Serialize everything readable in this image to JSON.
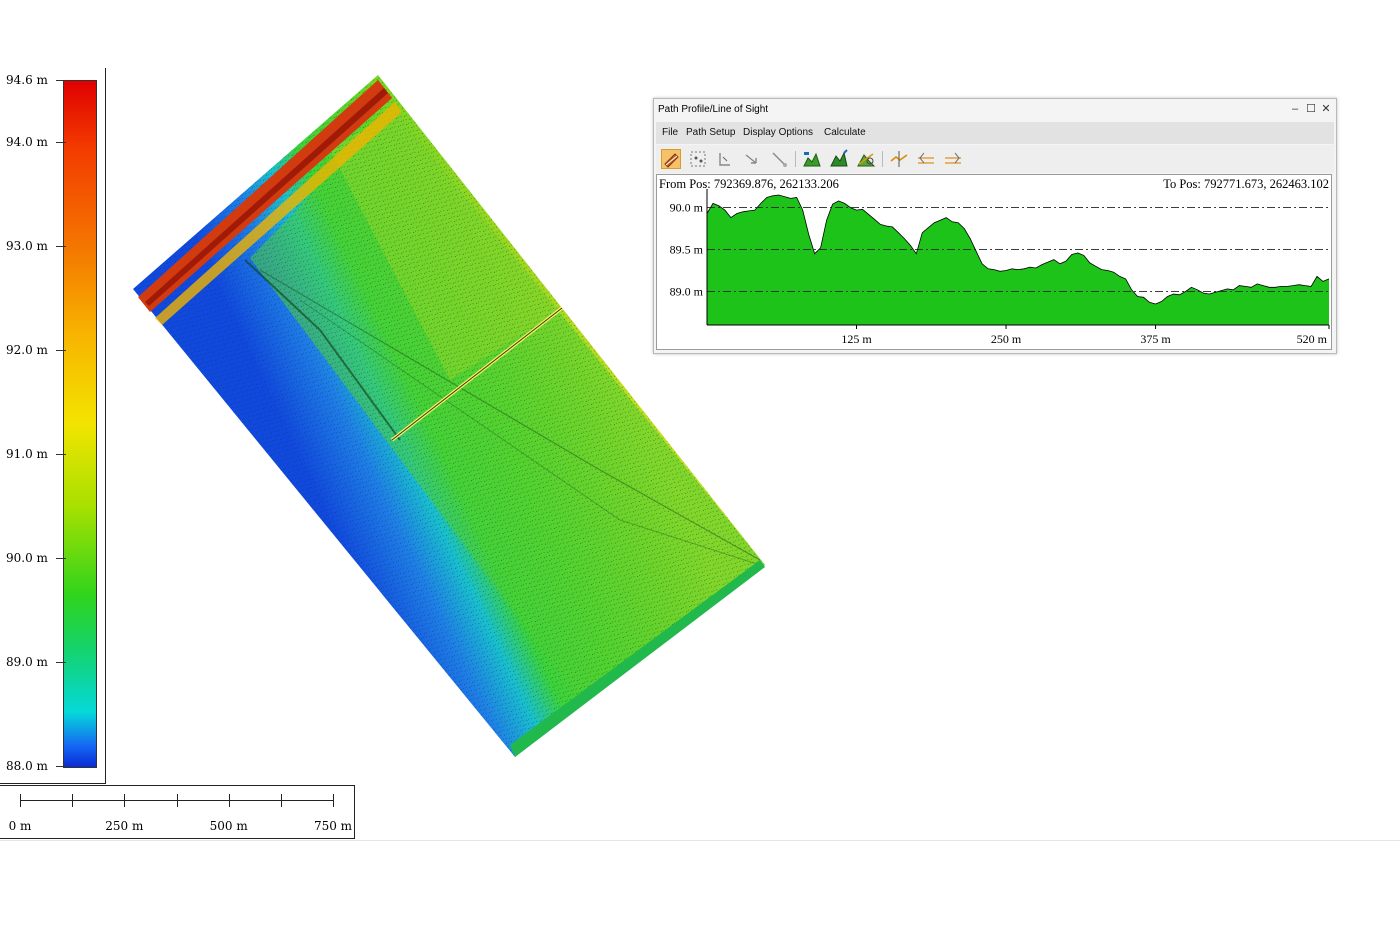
{
  "legend": {
    "ticks": [
      {
        "label": "94.6 m",
        "value": 94.6
      },
      {
        "label": "94.0 m",
        "value": 94.0
      },
      {
        "label": "93.0 m",
        "value": 93.0
      },
      {
        "label": "92.0 m",
        "value": 92.0
      },
      {
        "label": "91.0 m",
        "value": 91.0
      },
      {
        "label": "90.0 m",
        "value": 90.0
      },
      {
        "label": "89.0 m",
        "value": 89.0
      },
      {
        "label": "88.0 m",
        "value": 88.0
      }
    ],
    "min": 88.0,
    "max": 94.6,
    "colors_top_to_bottom": [
      "#e00000",
      "#f47a00",
      "#f2e400",
      "#2fd41c",
      "#05d9d9",
      "#0a2bd4"
    ]
  },
  "scale_bar": {
    "labels": [
      {
        "label": "0 m",
        "value": 0
      },
      {
        "label": "250 m",
        "value": 250
      },
      {
        "label": "500 m",
        "value": 500
      },
      {
        "label": "750 m",
        "value": 750
      }
    ],
    "max": 750,
    "minor_step": 125
  },
  "profile_window": {
    "title": "Path Profile/Line of Sight",
    "controls": {
      "minimize": "–",
      "maximize": "☐",
      "close": "✕"
    },
    "menu": [
      "File",
      "Path Setup",
      "Display Options",
      "Calculate"
    ],
    "toolbar_icons": [
      {
        "name": "draw-path-icon",
        "active": true
      },
      {
        "name": "select-points-icon",
        "active": false
      },
      {
        "name": "edit-points-icon",
        "active": false
      },
      {
        "name": "move-path-icon",
        "active": false
      },
      {
        "name": "clear-path-icon",
        "active": false
      },
      {
        "name": "terrain-profile-icon",
        "active": false
      },
      {
        "name": "terrain-fill-icon",
        "active": false
      },
      {
        "name": "line-of-sight-icon",
        "active": false
      },
      {
        "name": "add-marker-icon",
        "active": false
      },
      {
        "name": "prev-marker-icon",
        "active": false
      },
      {
        "name": "next-marker-icon",
        "active": false
      }
    ],
    "from_pos": "From Pos: 792369.876, 262133.206",
    "to_pos": "To Pos: 792771.673, 262463.102",
    "colors": {
      "fill": "#1ec31a",
      "stroke": "#000000",
      "gridline": "#222222"
    }
  },
  "chart_data": {
    "type": "area",
    "xlabel": "",
    "ylabel": "",
    "xlim": [
      0,
      520
    ],
    "ylim": [
      88.6,
      90.15
    ],
    "x_ticks": [
      {
        "label": "125 m",
        "value": 125
      },
      {
        "label": "250 m",
        "value": 250
      },
      {
        "label": "375 m",
        "value": 375
      },
      {
        "label": "520 m",
        "value": 520
      }
    ],
    "y_ticks": [
      {
        "label": "90.0 m",
        "value": 90.0
      },
      {
        "label": "89.5 m",
        "value": 89.5
      },
      {
        "label": "89.0 m",
        "value": 89.0
      }
    ],
    "grid": "dash-dot horizontal at y ticks",
    "x": [
      0,
      5,
      10,
      15,
      20,
      25,
      30,
      35,
      40,
      45,
      50,
      55,
      60,
      65,
      70,
      75,
      80,
      85,
      90,
      95,
      100,
      105,
      110,
      115,
      120,
      125,
      130,
      135,
      140,
      145,
      150,
      155,
      160,
      165,
      170,
      175,
      180,
      185,
      190,
      195,
      200,
      205,
      210,
      215,
      220,
      225,
      230,
      235,
      240,
      245,
      250,
      255,
      260,
      265,
      270,
      275,
      280,
      285,
      290,
      295,
      300,
      305,
      310,
      315,
      320,
      325,
      330,
      335,
      340,
      345,
      350,
      355,
      360,
      365,
      370,
      375,
      380,
      385,
      390,
      395,
      400,
      405,
      410,
      415,
      420,
      425,
      430,
      435,
      440,
      445,
      450,
      455,
      460,
      465,
      470,
      475,
      480,
      485,
      490,
      495,
      500,
      505,
      510,
      515,
      520
    ],
    "y": [
      89.93,
      90.05,
      90.02,
      89.97,
      89.88,
      89.93,
      89.95,
      89.96,
      89.97,
      90.05,
      90.12,
      90.14,
      90.15,
      90.13,
      90.11,
      90.12,
      89.97,
      89.68,
      89.45,
      89.52,
      89.85,
      90.04,
      90.08,
      90.05,
      90.0,
      89.97,
      89.98,
      89.92,
      89.86,
      89.8,
      89.78,
      89.77,
      89.7,
      89.63,
      89.55,
      89.45,
      89.7,
      89.76,
      89.82,
      89.85,
      89.88,
      89.83,
      89.82,
      89.75,
      89.63,
      89.48,
      89.33,
      89.27,
      89.26,
      89.24,
      89.25,
      89.27,
      89.26,
      89.27,
      89.29,
      89.28,
      89.32,
      89.35,
      89.38,
      89.33,
      89.36,
      89.44,
      89.46,
      89.43,
      89.34,
      89.3,
      89.26,
      89.25,
      89.23,
      89.18,
      89.15,
      89.02,
      88.94,
      88.93,
      88.87,
      88.85,
      88.88,
      88.94,
      88.97,
      88.96,
      89.0,
      89.05,
      89.02,
      88.98,
      88.97,
      88.99,
      89.01,
      89.03,
      89.02,
      89.07,
      89.06,
      89.05,
      89.09,
      89.07,
      89.05,
      89.05,
      89.06,
      89.06,
      89.07,
      89.08,
      89.07,
      89.06,
      89.18,
      89.12,
      89.15
    ]
  }
}
